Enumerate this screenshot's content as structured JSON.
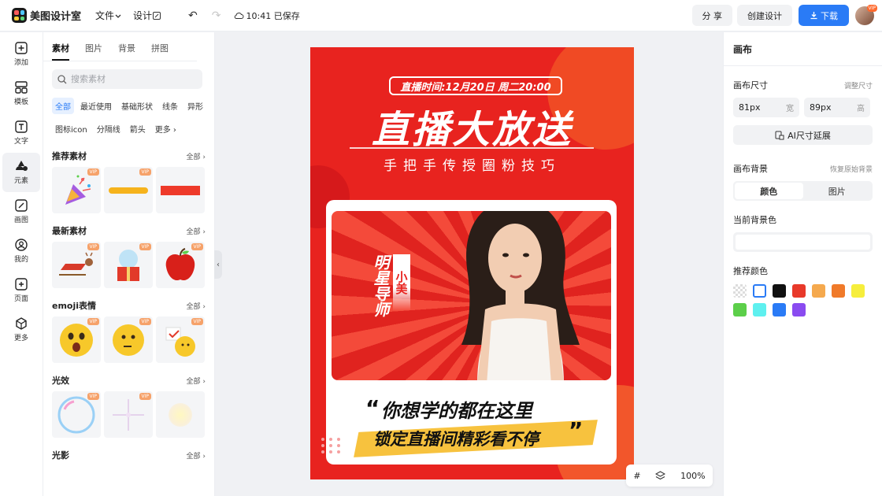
{
  "topbar": {
    "app_name": "美图设计室",
    "menu_file": "文件",
    "menu_design": "设计",
    "saved_status": "10:41 已保存",
    "share_label": "分 享",
    "create_label": "创建设计",
    "download_label": "下载",
    "avatar_badge": "VIP"
  },
  "rail": {
    "items": [
      {
        "label": "添加",
        "icon": "plus-square-icon"
      },
      {
        "label": "模板",
        "icon": "template-icon"
      },
      {
        "label": "文字",
        "icon": "text-icon"
      },
      {
        "label": "元素",
        "icon": "shapes-icon"
      },
      {
        "label": "画图",
        "icon": "draw-icon"
      },
      {
        "label": "我的",
        "icon": "user-icon"
      },
      {
        "label": "页面",
        "icon": "page-icon"
      },
      {
        "label": "更多",
        "icon": "cube-icon"
      }
    ],
    "active_index": 3
  },
  "panel": {
    "tabs": [
      "素材",
      "图片",
      "背景",
      "拼图"
    ],
    "search_placeholder": "搜索素材",
    "chips": [
      "全部",
      "最近使用",
      "基础形状",
      "线条",
      "异形",
      "图标icon",
      "分隔线",
      "箭头",
      "更多"
    ],
    "all_label": "全部",
    "vip_label": "VIP",
    "sections": [
      {
        "title": "推荐素材"
      },
      {
        "title": "最新素材"
      },
      {
        "title": "emoji表情"
      },
      {
        "title": "光效"
      },
      {
        "title": "光影"
      }
    ]
  },
  "poster": {
    "live_time": "直播时间:12月20日 周二20:00",
    "title": "直播大放送",
    "subtitle": "手把手传授圈粉技巧",
    "tag_star": "明星导师",
    "tag_name": "小美",
    "quote_line1": "你想学的都在这里",
    "quote_line2": "锁定直播间精彩看不停",
    "quote_open": "“",
    "quote_close": "”"
  },
  "zoom": {
    "level": "100%"
  },
  "right_panel": {
    "title": "画布",
    "size_label": "画布尺寸",
    "size_link": "调整尺寸",
    "width_value": "81px",
    "width_unit": "宽",
    "height_value": "89px",
    "height_unit": "高",
    "ai_button": "AI尺寸延展",
    "bg_label": "画布背景",
    "bg_reset": "恢复原始背景",
    "seg_color": "颜色",
    "seg_image": "图片",
    "current_bg_label": "当前背景色",
    "recommend_label": "推荐颜色",
    "colors": [
      "transparent",
      "#ffffff",
      "#111111",
      "#e8392a",
      "#f5a94e",
      "#f07a2a",
      "#f6ee3c",
      "#5ccf4a",
      "#5ef0ef",
      "#2a7bf6",
      "#8a4bf0"
    ]
  }
}
